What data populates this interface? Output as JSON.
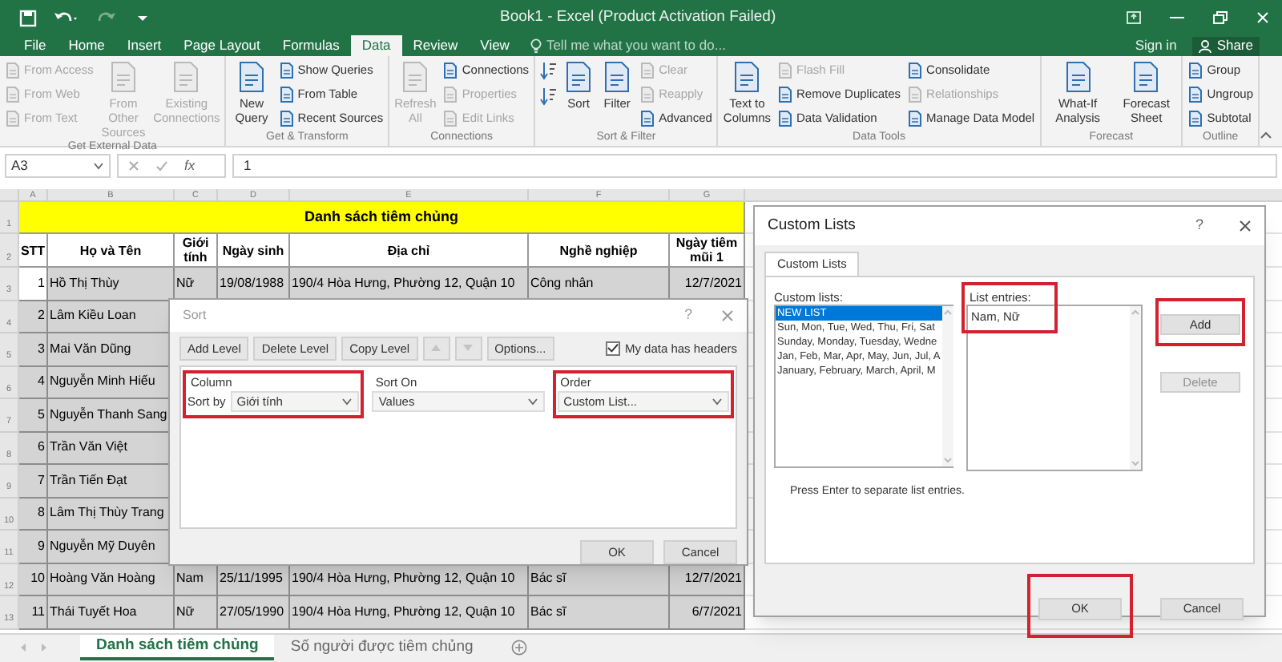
{
  "window": {
    "title": "Book1 - Excel (Product Activation Failed)"
  },
  "quick_access": [
    {
      "kind": "save",
      "disabled": false
    },
    {
      "kind": "undo",
      "disabled": false
    },
    {
      "kind": "redo",
      "disabled": true
    },
    {
      "kind": "customize",
      "disabled": false
    }
  ],
  "tabs": [
    {
      "label": "File",
      "selected": false
    },
    {
      "label": "Home",
      "selected": false
    },
    {
      "label": "Insert",
      "selected": false
    },
    {
      "label": "Page Layout",
      "selected": false
    },
    {
      "label": "Formulas",
      "selected": false
    },
    {
      "label": "Data",
      "selected": true
    },
    {
      "label": "Review",
      "selected": false
    },
    {
      "label": "View",
      "selected": false
    }
  ],
  "tell_me": {
    "placeholder": "Tell me what you want to do..."
  },
  "account": {
    "sign_in": "Sign in",
    "share": "Share"
  },
  "ribbon": {
    "groups": [
      {
        "label": "Get External Data",
        "items": [
          {
            "kind": "small",
            "label": "From Access",
            "disabled": true
          },
          {
            "kind": "small",
            "label": "From Web",
            "disabled": true
          },
          {
            "kind": "small",
            "label": "From Text",
            "disabled": true
          },
          {
            "kind": "large",
            "label": "From Other Sources",
            "disabled": true
          },
          {
            "kind": "large",
            "label": "Existing Connections",
            "disabled": true
          }
        ]
      },
      {
        "label": "Get & Transform",
        "items": [
          {
            "kind": "large",
            "label": "New Query",
            "disabled": false
          },
          {
            "kind": "small",
            "label": "Show Queries",
            "disabled": false
          },
          {
            "kind": "small",
            "label": "From Table",
            "disabled": false
          },
          {
            "kind": "small",
            "label": "Recent Sources",
            "disabled": false
          }
        ]
      },
      {
        "label": "Connections",
        "items": [
          {
            "kind": "large",
            "label": "Refresh All",
            "disabled": true
          },
          {
            "kind": "small",
            "label": "Connections",
            "disabled": false
          },
          {
            "kind": "small",
            "label": "Properties",
            "disabled": true
          },
          {
            "kind": "small",
            "label": "Edit Links",
            "disabled": true
          }
        ]
      },
      {
        "label": "Sort & Filter",
        "items": [
          {
            "kind": "icon",
            "disabled": false
          },
          {
            "kind": "icon",
            "disabled": false
          },
          {
            "kind": "large",
            "label": "Sort",
            "disabled": false
          },
          {
            "kind": "large",
            "label": "Filter",
            "disabled": false
          },
          {
            "kind": "small",
            "label": "Clear",
            "disabled": true
          },
          {
            "kind": "small",
            "label": "Reapply",
            "disabled": true
          },
          {
            "kind": "small",
            "label": "Advanced",
            "disabled": false
          }
        ]
      },
      {
        "label": "Data Tools",
        "items": [
          {
            "kind": "large",
            "label": "Text to Columns",
            "disabled": false
          },
          {
            "kind": "small",
            "label": "Flash Fill",
            "disabled": true
          },
          {
            "kind": "small",
            "label": "Remove Duplicates",
            "disabled": false
          },
          {
            "kind": "small",
            "label": "Data Validation",
            "disabled": false
          },
          {
            "kind": "small",
            "label": "Consolidate",
            "disabled": false
          },
          {
            "kind": "small",
            "label": "Relationships",
            "disabled": true
          },
          {
            "kind": "small",
            "label": "Manage Data Model",
            "disabled": false
          }
        ]
      },
      {
        "label": "Forecast",
        "items": [
          {
            "kind": "large",
            "label": "What-If Analysis",
            "disabled": false
          },
          {
            "kind": "large",
            "label": "Forecast Sheet",
            "disabled": false
          }
        ]
      },
      {
        "label": "Outline",
        "items": [
          {
            "kind": "small",
            "label": "Group",
            "disabled": false
          },
          {
            "kind": "small",
            "label": "Ungroup",
            "disabled": false
          },
          {
            "kind": "small",
            "label": "Subtotal",
            "disabled": false
          }
        ]
      }
    ]
  },
  "formula_bar": {
    "name_box": "A3",
    "function_label": "fx",
    "value": "1"
  },
  "sheet": {
    "columns": [
      "A",
      "B",
      "C",
      "D",
      "E",
      "F",
      "G"
    ],
    "title_row": {
      "number": "1",
      "title": "Danh sách tiêm chủng"
    },
    "header_row": {
      "number": "2",
      "cells": [
        "STT",
        "Họ và Tên",
        "Giới tính",
        "Ngày sinh",
        "Địa chỉ",
        "Nghề nghiệp",
        "Ngày tiêm mũi 1"
      ]
    },
    "rows": [
      {
        "number": "3",
        "active": true,
        "selected": true,
        "cells": [
          "1",
          "Hồ Thị Thùy",
          "Nữ",
          "19/08/1988",
          "190/4 Hòa Hưng, Phường 12, Quận 10",
          "Công nhân",
          "12/7/2021"
        ]
      },
      {
        "number": "4",
        "active": false,
        "selected": true,
        "cells": [
          "2",
          "Lâm Kiều Loan"
        ]
      },
      {
        "number": "5",
        "active": false,
        "selected": true,
        "cells": [
          "3",
          "Mai Văn Dũng"
        ]
      },
      {
        "number": "6",
        "active": false,
        "selected": true,
        "cells": [
          "4",
          "Nguyễn Minh Hiếu"
        ]
      },
      {
        "number": "7",
        "active": false,
        "selected": true,
        "cells": [
          "5",
          "Nguyễn Thanh Sang"
        ]
      },
      {
        "number": "8",
        "active": false,
        "selected": true,
        "cells": [
          "6",
          "Trần Văn Việt"
        ]
      },
      {
        "number": "9",
        "active": false,
        "selected": true,
        "cells": [
          "7",
          "Trần Tiến Đạt"
        ]
      },
      {
        "number": "10",
        "active": false,
        "selected": true,
        "cells": [
          "8",
          "Lâm Thị Thùy Trang"
        ]
      },
      {
        "number": "11",
        "active": false,
        "selected": true,
        "cells": [
          "9",
          "Nguyễn Mỹ Duyên"
        ]
      },
      {
        "number": "12",
        "active": false,
        "selected": true,
        "cells": [
          "10",
          "Hoàng Văn Hoàng",
          "Nam",
          "25/11/1995",
          "190/4 Hòa Hưng, Phường 12, Quận 10",
          "Bác sĩ",
          "12/7/2021"
        ]
      },
      {
        "number": "13",
        "active": false,
        "selected": true,
        "cells": [
          "11",
          "Thái Tuyết Hoa",
          "Nữ",
          "27/05/1990",
          "190/4 Hòa Hưng, Phường 12, Quận 10",
          "Bác sĩ",
          "6/7/2021"
        ]
      }
    ]
  },
  "sheet_tabs": [
    {
      "label": "Danh sách tiêm chủng",
      "selected": true
    },
    {
      "label": "Số người được tiêm chủng",
      "selected": false
    }
  ],
  "sort_dialog": {
    "title": "Sort",
    "help": "?",
    "toolbar": [
      {
        "kind": "text",
        "label": "Add Level",
        "disabled": false
      },
      {
        "kind": "text",
        "label": "Delete Level",
        "disabled": false
      },
      {
        "kind": "text",
        "label": "Copy Level",
        "disabled": false
      },
      {
        "kind": "up",
        "disabled": true
      },
      {
        "kind": "down",
        "disabled": true
      },
      {
        "kind": "text",
        "label": "Options...",
        "disabled": false
      }
    ],
    "headers_checkbox": {
      "label": "My data has headers",
      "checked": true
    },
    "sections": [
      {
        "heading": "Column",
        "label": "Sort by",
        "value": "Giới tính",
        "highlighted": true
      },
      {
        "heading": "Sort On",
        "value": "Values",
        "highlighted": false
      },
      {
        "heading": "Order",
        "value": "Custom List...",
        "highlighted": true
      }
    ],
    "buttons": [
      {
        "label": "OK"
      },
      {
        "label": "Cancel"
      }
    ]
  },
  "custom_lists_dialog": {
    "title": "Custom Lists",
    "help": "?",
    "tabs": [
      {
        "label": "Custom Lists",
        "selected": true
      }
    ],
    "lists_label": "Custom lists:",
    "lists": [
      {
        "label": "NEW LIST",
        "selected": true
      },
      {
        "label": "Sun, Mon, Tue, Wed, Thu, Fri, Sat",
        "selected": false
      },
      {
        "label": "Sunday, Monday, Tuesday, Wedne",
        "selected": false
      },
      {
        "label": "Jan, Feb, Mar, Apr, May, Jun, Jul, A",
        "selected": false
      },
      {
        "label": "January, February, March, April, M",
        "selected": false
      }
    ],
    "entries_label": "List entries:",
    "entries": "Nam, Nữ",
    "entries_highlighted": true,
    "side_buttons": [
      {
        "label": "Add",
        "disabled": false,
        "highlighted": true
      },
      {
        "label": "Delete",
        "disabled": true,
        "highlighted": false
      }
    ],
    "hint": "Press Enter to separate list entries.",
    "buttons": [
      {
        "label": "OK",
        "highlighted": true
      },
      {
        "label": "Cancel",
        "highlighted": false
      }
    ]
  }
}
